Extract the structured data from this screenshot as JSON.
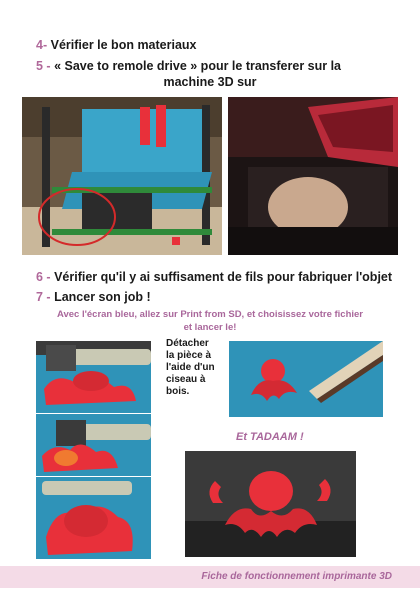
{
  "steps": {
    "s4_num": "4-",
    "s4_text": "Vérifier le bon materiaux",
    "s5_num": "5 -",
    "s5_text_a": "« Save to remole drive » pour le transferer sur la",
    "s5_text_b": "machine 3D sur",
    "s6_num": "6 -",
    "s6_text": "Vérifier qu'il y ai suffisament de fils pour fabriquer l'objet",
    "s7_num": "7 -",
    "s7_text": "Lancer son job !"
  },
  "note": {
    "line1": "Avec l'écran bleu, allez sur Print from SD, et choisissez votre fichier",
    "line2": "et lancer le!"
  },
  "detach": {
    "line1": "Détacher",
    "line2": "la pièce à",
    "line3": "l'aide d'un",
    "line4": "ciseau à",
    "line5": "bois."
  },
  "tadaam": "Et TADAAM !",
  "footer": "Fiche de fonctionnement imprimante 3D",
  "colors": {
    "accent": "#b0689a",
    "print_red": "#e8303a",
    "bed_blue": "#3aa5c9",
    "frame_green": "#2f8a3a",
    "footer_band": "#f4dbe7"
  }
}
